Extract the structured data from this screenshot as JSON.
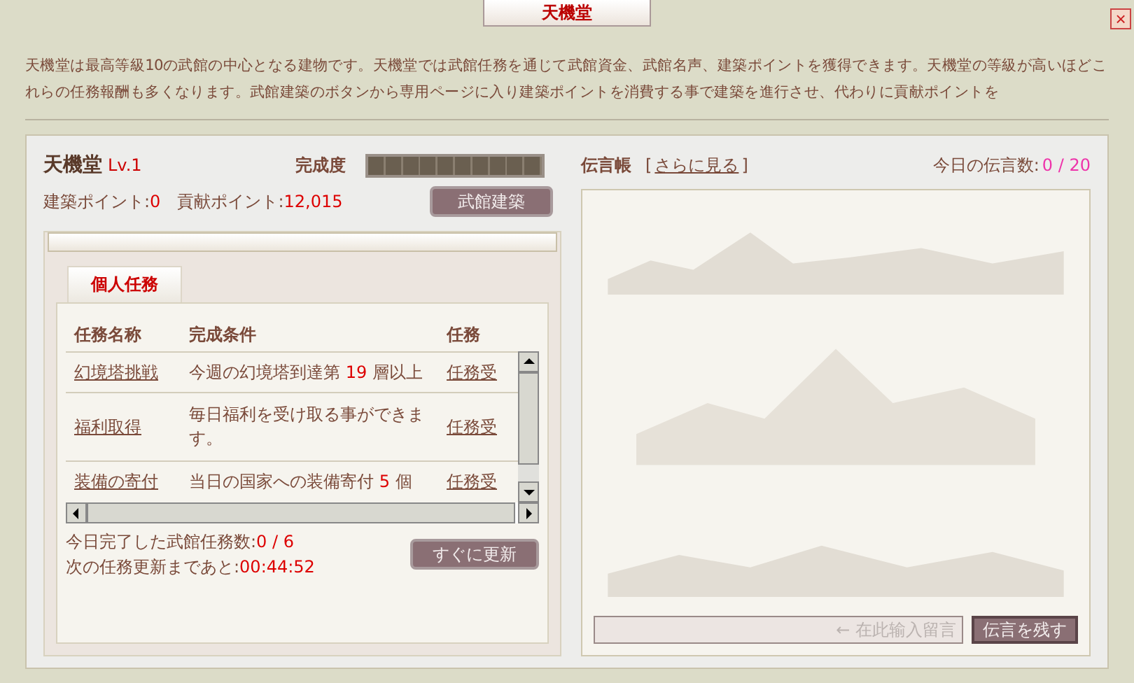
{
  "window": {
    "title": "天機堂",
    "close": "×"
  },
  "description": "天機堂は最高等級10の武館の中心となる建物です。天機堂では武館任務を通じて武館資金、武館名声、建築ポイントを獲得できます。天機堂の等級が高いほどこれらの任務報酬も多くなります。武館建築のボタンから専用ページに入り建築ポイントを消費する事で建築を進行させ、代わりに貢献ポイントを",
  "building": {
    "name": "天機堂",
    "level": "Lv.1",
    "progress_label": "完成度",
    "progress": {
      "level": 0
    },
    "build_points_label": "建築ポイント:",
    "build_points": "0",
    "contribution_label": "貢献ポイント:",
    "contribution": "12,015",
    "build_button": "武館建築"
  },
  "tabs": [
    {
      "label": "個人任務",
      "selected": true
    }
  ],
  "table": {
    "columns": [
      "任務名称",
      "完成条件",
      "任務"
    ],
    "rows": [
      {
        "name": "幻境塔挑戦",
        "condition": [
          "今週の幻境塔到達第 ",
          "19",
          " 層以上"
        ],
        "action": "任務受"
      },
      {
        "name": "福利取得",
        "condition": [
          "毎日福利を受け取る事ができます。"
        ],
        "action": "任務受"
      },
      {
        "name": "装備の寄付",
        "condition": [
          "当日の国家への装備寄付 ",
          "5",
          " 個"
        ],
        "action": "任務受"
      }
    ]
  },
  "completed_label": "今日完了した武館任務数:",
  "completed": "0 / 6",
  "next_update_label": "次の任務更新まであと:",
  "next_update": "00:44:52",
  "refresh_button": "すぐに更新",
  "message_board": {
    "title": "伝言帳",
    "bracket_open": "[",
    "more_link": "さらに見る",
    "bracket_close": "]",
    "count_label": "今日の伝言数:",
    "count": "0 / 20",
    "input_placeholder": "← 在此输入留言",
    "post_button": "伝言を残す"
  }
}
